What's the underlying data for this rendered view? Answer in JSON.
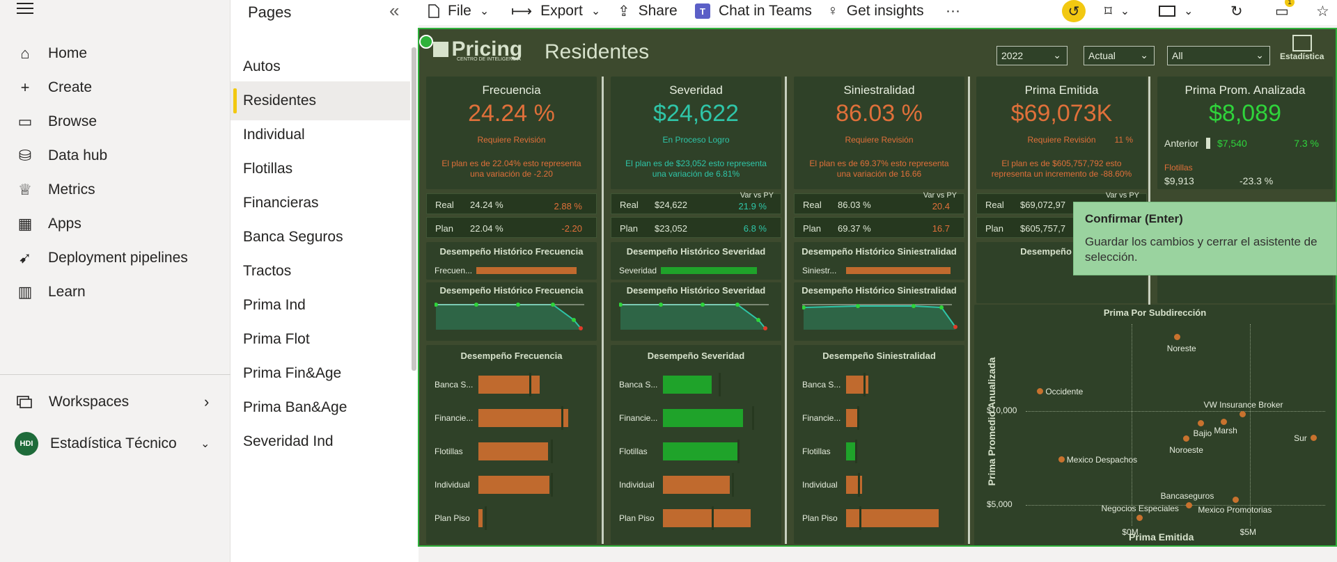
{
  "nav": {
    "items": [
      {
        "label": "Home",
        "icon": "home-icon"
      },
      {
        "label": "Create",
        "icon": "plus-icon"
      },
      {
        "label": "Browse",
        "icon": "folder-icon"
      },
      {
        "label": "Data hub",
        "icon": "database-icon"
      },
      {
        "label": "Metrics",
        "icon": "trophy-icon"
      },
      {
        "label": "Apps",
        "icon": "apps-icon"
      },
      {
        "label": "Deployment pipelines",
        "icon": "rocket-icon"
      },
      {
        "label": "Learn",
        "icon": "book-icon"
      }
    ],
    "workspaces": "Workspaces",
    "workspace_name": "Estadística Técnico",
    "workspace_badge": "HDI"
  },
  "pages": {
    "title": "Pages",
    "items": [
      "Autos",
      "Residentes",
      "Individual",
      "Flotillas",
      "Financieras",
      "Banca Seguros",
      "Tractos",
      "Prima Ind",
      "Prima Flot",
      "Prima Fin&Age",
      "Prima Ban&Age",
      "Severidad Ind"
    ],
    "active_index": 1
  },
  "toolbar": {
    "file": "File",
    "export": "Export",
    "share": "Share",
    "chat": "Chat in Teams",
    "insights": "Get insights",
    "more": "···",
    "notif_count": "1"
  },
  "report": {
    "brand": "Pricing",
    "brand_sub": "CENTRO DE INTELIGENCIA",
    "title": "Residentes",
    "estadistica": "Estadística",
    "filters": {
      "year": "2022",
      "scenario": "Actual",
      "scope": "All"
    },
    "colors": {
      "orange": "#e0703a",
      "green": "#2fd43b",
      "teal": "#2fc5a8",
      "bar_orange": "#c06a2e",
      "bar_green": "#1fa32a"
    },
    "cards": [
      {
        "title": "Frecuencia",
        "value": "24.24 %",
        "color": "orange",
        "status": "Requiere Revisión",
        "note": "El plan es de 22.04% esto representa una variación de -2.20",
        "real_label": "Real",
        "real": "24.24 %",
        "real_var": "2.88 %",
        "plan_label": "Plan",
        "plan": "22.04 %",
        "plan_var": "-2.20",
        "var_hdr": "",
        "hist_title": "Desempeño Histórico Frecuencia",
        "hist_label": "Frecuen...",
        "hist_title2": "Desempeño Histórico Frecuencia",
        "perf_title": "Desempeño Frecuencia",
        "perf_labels": [
          "Banca S...",
          "Financie...",
          "Flotillas",
          "Individual",
          "Plan Piso"
        ],
        "perf_values": [
          0.61,
          0.89,
          0.69,
          0.7,
          0.04
        ],
        "perf_marks": [
          0.5,
          0.82,
          0.72,
          0.72,
          0.06
        ],
        "bar_color": "orange"
      },
      {
        "title": "Severidad",
        "value": "$24,622",
        "color": "teal",
        "status": "En Proceso Logro",
        "note": "El plan es de $23,052 esto representa una variación de 6.81%",
        "real_label": "Real",
        "real": "$24,622",
        "real_var": "21.9 %",
        "plan_label": "Plan",
        "plan": "$23,052",
        "plan_var": "6.8 %",
        "var_hdr": "Var vs PY",
        "hist_title": "Desempeño Histórico Severidad",
        "hist_label": "Severidad",
        "hist_title2": "Desempeño Histórico Severidad",
        "perf_title": "Desempeño Severidad",
        "perf_labels": [
          "Banca S...",
          "Financie...",
          "Flotillas",
          "Individual",
          "Plan Piso"
        ],
        "perf_values": [
          0.48,
          0.79,
          0.74,
          0.66,
          0.87
        ],
        "perf_marks": [
          0.55,
          0.88,
          0.74,
          0.68,
          0.48
        ],
        "bar_color": "mixed"
      },
      {
        "title": "Siniestralidad",
        "value": "86.03 %",
        "color": "orange",
        "status": "Requiere Revisión",
        "note": "El plan es de 69.37% esto representa una variación de 16.66",
        "real_label": "Real",
        "real": "86.03 %",
        "real_var": "20.4",
        "plan_label": "Plan",
        "plan": "69.37 %",
        "plan_var": "16.7",
        "var_hdr": "Var vs PY",
        "hist_title": "Desempeño Histórico Siniestralidad",
        "hist_label": "Siniestr...",
        "hist_title2": "Desempeño Histórico Siniestralidad",
        "perf_title": "Desempeño Siniestralidad",
        "perf_labels": [
          "Banca S...",
          "Financie...",
          "Flotillas",
          "Individual",
          "Plan Piso"
        ],
        "perf_values": [
          0.22,
          0.11,
          0.09,
          0.16,
          0.92
        ],
        "perf_marks": [
          0.17,
          0.11,
          0.09,
          0.12,
          0.13
        ],
        "bar_color": "mixed"
      },
      {
        "title": "Prima Emitida",
        "value": "$69,073K",
        "color": "orange",
        "status": "Requiere Revisión",
        "status_extra": "11 %",
        "note": "El plan es de $605,757,792 esto representa un incremento de -88.60%",
        "real_label": "Real",
        "real": "$69,072,97",
        "real_var": "",
        "plan_label": "Plan",
        "plan": "$605,757,7",
        "plan_var": "",
        "var_hdr": "Var vs PY",
        "hist_title": "Desempeño Históri"
      },
      {
        "title": "Prima Prom. Analizada",
        "value": "$8,089",
        "color": "green",
        "anterior_label": "Anterior",
        "anterior": "$7,540",
        "anterior_var": "7.3 %",
        "flot_label": "Flotillas",
        "flot": "$9,913",
        "flot_var": "-23.3 %"
      }
    ],
    "scatter": {
      "title": "Prima Por Subdirección",
      "xlabel": "Prima Emitida",
      "ylabel": "Prima Promedio Anualizada",
      "yticks": [
        "$10,000",
        "$5,000"
      ],
      "xticks": [
        "$0M",
        "$5M"
      ]
    }
  },
  "chart_data": {
    "type": "scatter",
    "title": "Prima Por Subdirección",
    "xlabel": "Prima Emitida",
    "ylabel": "Prima Promedio Anualizada",
    "points": [
      {
        "label": "Noreste",
        "x": 1.9,
        "y": 13950
      },
      {
        "label": "Occidente",
        "x": -3.9,
        "y": 11050
      },
      {
        "label": "VW Insurance Broker",
        "x": 4.7,
        "y": 9850
      },
      {
        "label": "Bajio",
        "x": 2.9,
        "y": 9350
      },
      {
        "label": "Marsh",
        "x": 3.9,
        "y": 9450
      },
      {
        "label": "Noroeste",
        "x": 2.3,
        "y": 8550
      },
      {
        "label": "Sur",
        "x": 7.7,
        "y": 8600
      },
      {
        "label": "Mexico Despachos",
        "x": -3.0,
        "y": 7450
      },
      {
        "label": "Bancaseguros",
        "x": 2.4,
        "y": 5000
      },
      {
        "label": "Mexico Promotorias",
        "x": 4.4,
        "y": 5300
      },
      {
        "label": "Negocios Especiales",
        "x": 0.3,
        "y": 4350
      }
    ],
    "xticks": [
      "$0M",
      "$5M"
    ],
    "yticks": [
      "$10,000",
      "$5,000"
    ]
  },
  "tooltip": {
    "title": "Confirmar (Enter)",
    "body": "Guardar los cambios y cerrar el asistente de selección."
  }
}
